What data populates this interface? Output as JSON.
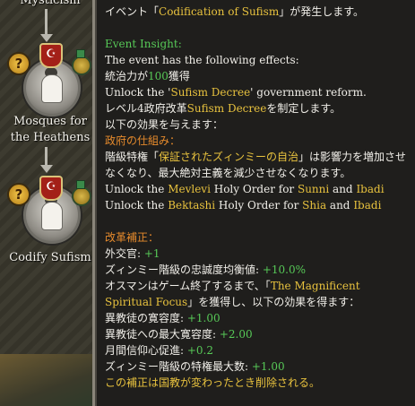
{
  "missions": [
    {
      "title": "Mysticism"
    },
    {
      "title_line1": "Mosques for",
      "title_line2": "the Heathens"
    },
    {
      "title": "Codify Sufism"
    }
  ],
  "badges": {
    "question": "?",
    "crescent": "☪"
  },
  "tooltip": {
    "event_pre": "イベント「",
    "event_name": "Codification of Sufism",
    "event_post": "」が発生します。",
    "insight_label": "Event Insight:",
    "effects_intro": "The event has the following effects:",
    "prestige_pre": "統治力が",
    "prestige_value": "100",
    "prestige_post": "獲得",
    "unlock_pre": "Unlock the '",
    "unlock_reform": "Sufism Decree",
    "unlock_post": "' government reform.",
    "level4_pre": "レベル4政府改革",
    "level4_reform": "Sufism Decree",
    "level4_post": "を制定します。",
    "effects_below": "以下の効果を与えます：",
    "gov_mech_label": "政府の仕組み：",
    "privilege_pre": "階級特権「",
    "privilege_name": "保証されたズィンミーの自治",
    "privilege_post": "」は影響力を増加させ",
    "privilege_line2": "なくなり、最大絶対主義を減少させなくなります。",
    "mevlevi_pre": "Unlock the ",
    "mevlevi_name": "Mevlevi",
    "mevlevi_mid": " Holy Order for ",
    "mevlevi_f1": "Sunni",
    "mevlevi_and": " and ",
    "mevlevi_f2": "Ibadi",
    "bektashi_pre": "Unlock the ",
    "bektashi_name": "Bektashi",
    "bektashi_mid": " Holy Order for ",
    "bektashi_f1": "Shia",
    "bektashi_and": " and ",
    "bektashi_f2": "Ibadi",
    "modifier_label": "改革補正：",
    "diplomat_label": "外交官: ",
    "diplomat_value": "+1",
    "loyalty_label": "ズィンミー階級の忠誠度均衡値: ",
    "loyalty_value": "+10.0%",
    "ottoman_pre": "オスマンはゲーム終了するまで、「",
    "ottoman_mod": "The Magnificent",
    "ottoman_mod2": "Spiritual Focus",
    "ottoman_post": "」を獲得し、以下の効果を得ます：",
    "tol_heretic_label": "異教徒の寛容度: ",
    "tol_heretic_value": "+1.00",
    "tol_heathen_label": "異教徒への最大寛容度: ",
    "tol_heathen_value": "+2.00",
    "piety_label": "月間信仰心促進: ",
    "piety_value": "+0.2",
    "dhimmi_label": "ズィンミー階級の特権最大数: ",
    "dhimmi_value": "+1.00",
    "removal_note": "この補正は国教が変わったとき削除される。"
  },
  "colors": {
    "gold": "#e8c23e",
    "green": "#57c957",
    "orange": "#e58a2c",
    "text": "#f1efe9"
  }
}
